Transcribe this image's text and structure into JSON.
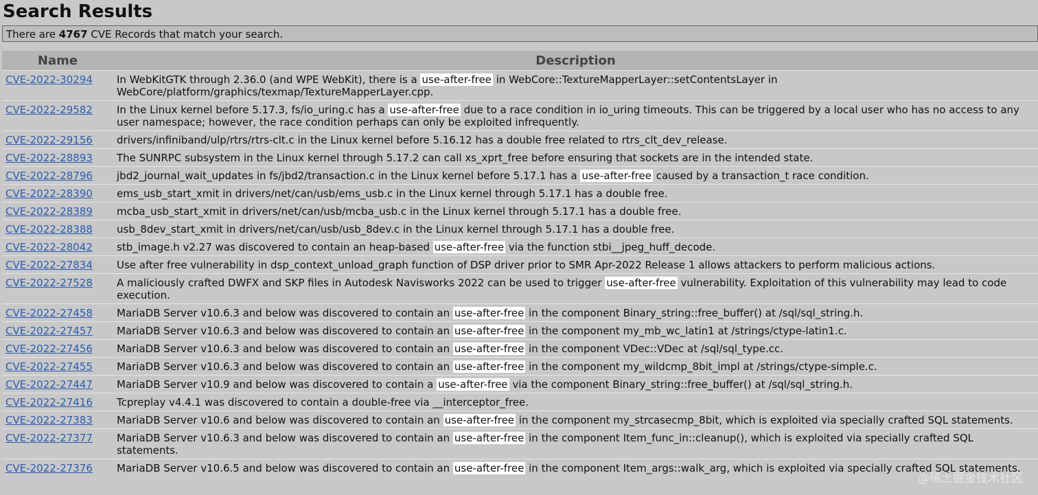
{
  "page_title": "Search Results",
  "summary": {
    "prefix": "There are ",
    "count": "4767",
    "suffix": " CVE Records that match your search."
  },
  "table": {
    "headers": {
      "name": "Name",
      "description": "Description"
    },
    "highlight_term": "use-after-free",
    "rows": [
      {
        "id": "CVE-2022-30294",
        "description": "In WebKitGTK through 2.36.0 (and WPE WebKit), there is a use-after-free in WebCore::TextureMapperLayer::setContentsLayer in WebCore/platform/graphics/texmap/TextureMapperLayer.cpp."
      },
      {
        "id": "CVE-2022-29582",
        "description": "In the Linux kernel before 5.17.3, fs/io_uring.c has a use-after-free due to a race condition in io_uring timeouts. This can be triggered by a local user who has no access to any user namespace; however, the race condition perhaps can only be exploited infrequently."
      },
      {
        "id": "CVE-2022-29156",
        "description": "drivers/infiniband/ulp/rtrs/rtrs-clt.c in the Linux kernel before 5.16.12 has a double free related to rtrs_clt_dev_release."
      },
      {
        "id": "CVE-2022-28893",
        "description": "The SUNRPC subsystem in the Linux kernel through 5.17.2 can call xs_xprt_free before ensuring that sockets are in the intended state."
      },
      {
        "id": "CVE-2022-28796",
        "description": "jbd2_journal_wait_updates in fs/jbd2/transaction.c in the Linux kernel before 5.17.1 has a use-after-free caused by a transaction_t race condition."
      },
      {
        "id": "CVE-2022-28390",
        "description": "ems_usb_start_xmit in drivers/net/can/usb/ems_usb.c in the Linux kernel through 5.17.1 has a double free."
      },
      {
        "id": "CVE-2022-28389",
        "description": "mcba_usb_start_xmit in drivers/net/can/usb/mcba_usb.c in the Linux kernel through 5.17.1 has a double free."
      },
      {
        "id": "CVE-2022-28388",
        "description": "usb_8dev_start_xmit in drivers/net/can/usb/usb_8dev.c in the Linux kernel through 5.17.1 has a double free."
      },
      {
        "id": "CVE-2022-28042",
        "description": "stb_image.h v2.27 was discovered to contain an heap-based use-after-free via the function stbi__jpeg_huff_decode."
      },
      {
        "id": "CVE-2022-27834",
        "description": "Use after free vulnerability in dsp_context_unload_graph function of DSP driver prior to SMR Apr-2022 Release 1 allows attackers to perform malicious actions."
      },
      {
        "id": "CVE-2022-27528",
        "description": "A maliciously crafted DWFX and SKP files in Autodesk Navisworks 2022 can be used to trigger use-after-free vulnerability. Exploitation of this vulnerability may lead to code execution."
      },
      {
        "id": "CVE-2022-27458",
        "description": "MariaDB Server v10.6.3 and below was discovered to contain an use-after-free in the component Binary_string::free_buffer() at /sql/sql_string.h."
      },
      {
        "id": "CVE-2022-27457",
        "description": "MariaDB Server v10.6.3 and below was discovered to contain an use-after-free in the component my_mb_wc_latin1 at /strings/ctype-latin1.c."
      },
      {
        "id": "CVE-2022-27456",
        "description": "MariaDB Server v10.6.3 and below was discovered to contain an use-after-free in the component VDec::VDec at /sql/sql_type.cc."
      },
      {
        "id": "CVE-2022-27455",
        "description": "MariaDB Server v10.6.3 and below was discovered to contain an use-after-free in the component my_wildcmp_8bit_impl at /strings/ctype-simple.c."
      },
      {
        "id": "CVE-2022-27447",
        "description": "MariaDB Server v10.9 and below was discovered to contain a use-after-free via the component Binary_string::free_buffer() at /sql/sql_string.h."
      },
      {
        "id": "CVE-2022-27416",
        "description": "Tcpreplay v4.4.1 was discovered to contain a double-free via __interceptor_free."
      },
      {
        "id": "CVE-2022-27383",
        "description": "MariaDB Server v10.6 and below was discovered to contain an use-after-free in the component my_strcasecmp_8bit, which is exploited via specially crafted SQL statements."
      },
      {
        "id": "CVE-2022-27377",
        "description": "MariaDB Server v10.6.3 and below was discovered to contain an use-after-free in the component Item_func_in::cleanup(), which is exploited via specially crafted SQL statements."
      },
      {
        "id": "CVE-2022-27376",
        "description": "MariaDB Server v10.6.5 and below was discovered to contain an use-after-free in the component Item_args::walk_arg, which is exploited via specially crafted SQL statements."
      }
    ]
  },
  "watermark": "@稀土掘金技术社区"
}
